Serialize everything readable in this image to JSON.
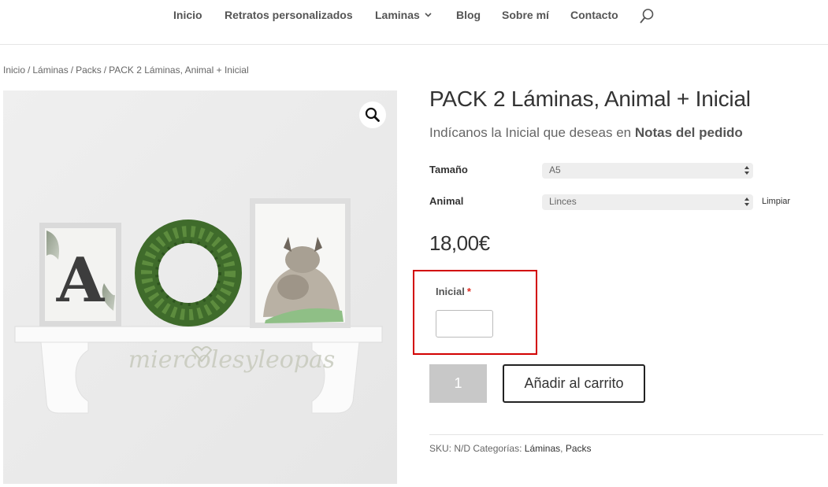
{
  "nav": {
    "items": [
      {
        "label": "Inicio"
      },
      {
        "label": "Retratos personalizados"
      },
      {
        "label": "Laminas"
      },
      {
        "label": "Blog"
      },
      {
        "label": "Sobre mí"
      },
      {
        "label": "Contacto"
      }
    ],
    "search_icon": "search-icon"
  },
  "breadcrumb": {
    "items": [
      "Inicio",
      "Láminas",
      "Packs"
    ],
    "current": "PACK 2 Láminas, Animal + Inicial",
    "separator": "/"
  },
  "gallery": {
    "watermark": "miercolesyleopas",
    "zoom_icon": "magnifier-icon",
    "print_letter": "A"
  },
  "product": {
    "title": "PACK 2 Láminas, Animal + Inicial",
    "subtitle_prefix": "Indícanos la Inicial que deseas en",
    "subtitle_strong": "Notas del pedido",
    "variations": [
      {
        "label": "Tamaño",
        "value": "A5"
      },
      {
        "label": "Animal",
        "value": "Linces"
      }
    ],
    "reset_label": "Limpiar",
    "price": "18,00€",
    "addon": {
      "label": "Inicial",
      "required_mark": "*",
      "value": ""
    },
    "quantity": "1",
    "add_to_cart_label": "Añadir al carrito",
    "meta": {
      "sku_label": "SKU:",
      "sku_value": "N/D",
      "categories_label": "Categorías:",
      "categories": [
        "Láminas",
        "Packs"
      ],
      "categories_separator": ","
    }
  },
  "colors": {
    "highlight": "#d20000",
    "required": "#e02b20",
    "quantity_bg": "#c8c8c8"
  }
}
